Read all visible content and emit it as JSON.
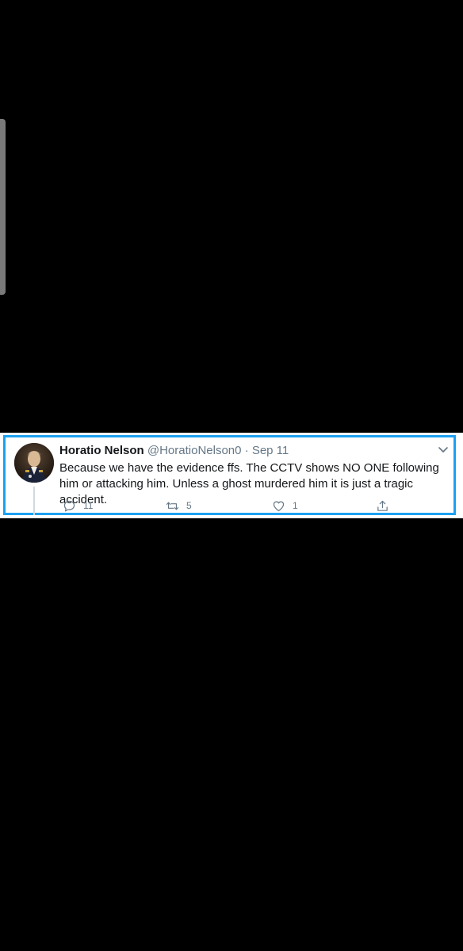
{
  "tweet": {
    "display_name": "Horatio Nelson",
    "handle": "@HoratioNelson0",
    "separator": "·",
    "date": "Sep 11",
    "text": "Because we have the evidence ffs. The CCTV shows NO ONE following him or attacking him. Unless a ghost murdered him it is just a tragic accident.",
    "reply_count": "11",
    "retweet_count": "5",
    "like_count": "1"
  },
  "colors": {
    "accent_border": "#1da1f2",
    "secondary_text": "#657786",
    "primary_text": "#14171a",
    "background": "#000000"
  },
  "icons": {
    "reply": "reply-icon",
    "retweet": "retweet-icon",
    "like": "heart-icon",
    "share": "share-icon",
    "more": "chevron-down-icon"
  }
}
